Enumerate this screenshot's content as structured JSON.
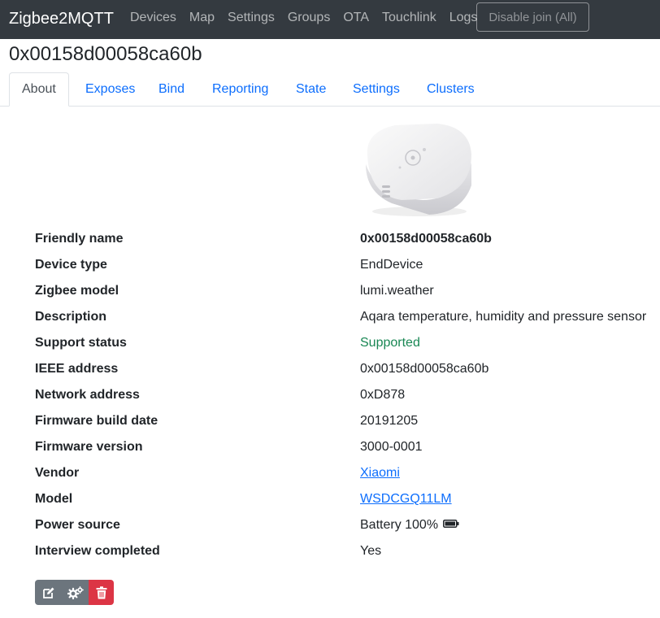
{
  "navbar": {
    "brand": "Zigbee2MQTT",
    "links": [
      "Devices",
      "Map",
      "Settings",
      "Groups",
      "OTA",
      "Touchlink",
      "Logs"
    ],
    "join_button": "Disable join (All)"
  },
  "page": {
    "title": "0x00158d00058ca60b"
  },
  "tabs": [
    "About",
    "Exposes",
    "Bind",
    "Reporting",
    "State",
    "Settings",
    "Clusters"
  ],
  "device": {
    "image_icon": "sensor-device-image"
  },
  "info": [
    {
      "label": "Friendly name",
      "value": "0x00158d00058ca60b"
    },
    {
      "label": "Device type",
      "value": "EndDevice"
    },
    {
      "label": "Zigbee model",
      "value": "lumi.weather"
    },
    {
      "label": "Description",
      "value": "Aqara temperature, humidity and pressure sensor"
    },
    {
      "label": "Support status",
      "value": "Supported"
    },
    {
      "label": "IEEE address",
      "value": "0x00158d00058ca60b"
    },
    {
      "label": "Network address",
      "value": "0xD878"
    },
    {
      "label": "Firmware build date",
      "value": "20191205"
    },
    {
      "label": "Firmware version",
      "value": "3000-0001"
    },
    {
      "label": "Vendor",
      "value": "Xiaomi"
    },
    {
      "label": "Model",
      "value": "WSDCGQ11LM"
    },
    {
      "label": "Power source",
      "value": "Battery 100%"
    },
    {
      "label": "Interview completed",
      "value": "Yes"
    }
  ],
  "actions": {
    "icons": [
      "edit-icon",
      "cogs-icon",
      "trash-icon"
    ]
  },
  "colors": {
    "navbar": "#343a40",
    "link": "#0d6efd",
    "supported": "#198754",
    "danger": "#dc3545",
    "secondary": "#6c757d"
  }
}
